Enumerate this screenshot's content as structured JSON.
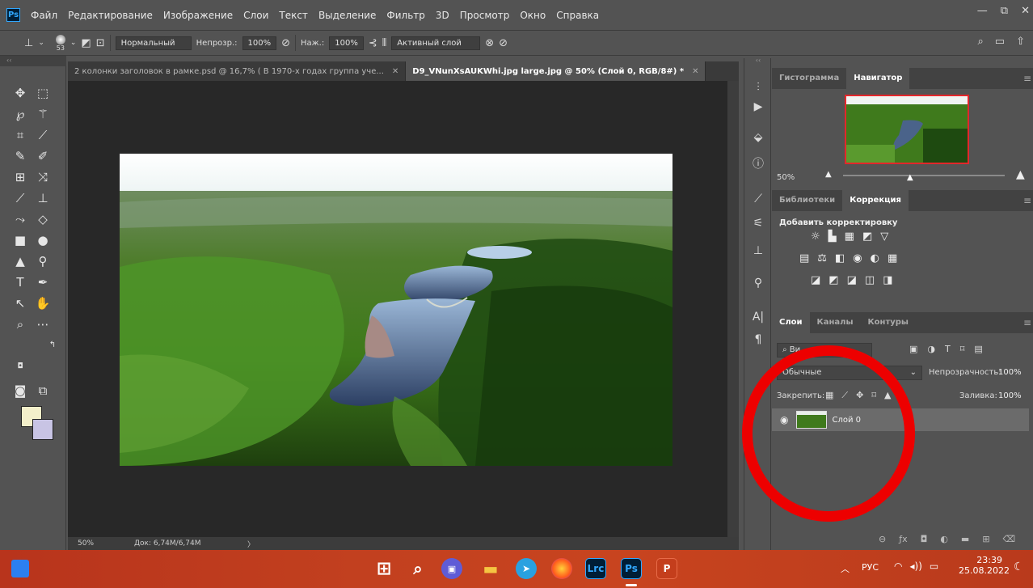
{
  "app": {
    "logo": "Ps"
  },
  "menu": [
    "Файл",
    "Редактирование",
    "Изображение",
    "Слои",
    "Текст",
    "Выделение",
    "Фильтр",
    "3D",
    "Просмотр",
    "Окно",
    "Справка"
  ],
  "window_controls": [
    "—",
    "⧉",
    "✕"
  ],
  "options": {
    "brush_size": "53",
    "mode": "Нормальный",
    "opacity_label": "Непрозр.:",
    "opacity_value": "100%",
    "pressure_label": "Наж.:",
    "pressure_value": "100%",
    "sample": "Активный слой"
  },
  "tabs": [
    {
      "label": "2 колонки заголовок в рамке.psd @ 16,7% (  В 1970-х годах группа уче...",
      "close": "✕"
    },
    {
      "label": "D9_VNunXsAUKWhi.jpg large.jpg @ 50% (Слой 0, RGB/8#) *",
      "close": "✕"
    }
  ],
  "status": {
    "zoom": "50%",
    "doc": "Док: 6,74M/6,74M",
    "arrow": "〉"
  },
  "panels": {
    "top_tabs": [
      "Гистограмма",
      "Навигатор"
    ],
    "nav_zoom": "50%",
    "mid_tabs": [
      "Библиотеки",
      "Коррекция"
    ],
    "add_adjustment": "Добавить корректировку",
    "adj_row1": [
      "☼",
      "▙",
      "▦",
      "◩",
      "▽"
    ],
    "adj_row2": [
      "▤",
      "⚖",
      "◧",
      "◉",
      "◐",
      "▦"
    ],
    "adj_row3": [
      "◪",
      "◩",
      "◪",
      "◫",
      "◨"
    ],
    "layer_tabs": [
      "Слои",
      "Каналы",
      "Контуры"
    ],
    "search_placeholder": "Ви",
    "blend": "Обычные",
    "opacity_label": "Непрозрачность:",
    "opacity_value": "100%",
    "lock_label": "Закрепить:",
    "fill_label": "Заливка:",
    "fill_value": "100%",
    "layer_name": "Слой 0"
  },
  "taskbar": {
    "lang": "РУС",
    "time": "23:39",
    "date": "25.08.2022",
    "apps": [
      "Lrc",
      "Ps",
      "P"
    ]
  },
  "colors": {
    "foreground": "#f3efca",
    "background": "#c8c4e4",
    "highlight": "#ed0000"
  }
}
